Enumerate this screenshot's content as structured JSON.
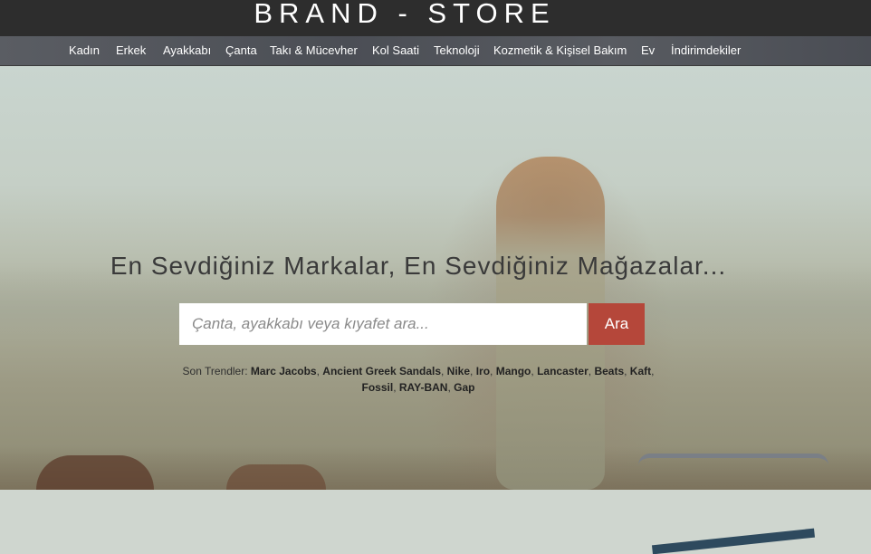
{
  "header": {
    "logo": "BRAND - STORE"
  },
  "nav": {
    "items": [
      {
        "label": "Kadın"
      },
      {
        "label": "Erkek"
      },
      {
        "label": "Ayakkabı"
      },
      {
        "label": "Çanta"
      },
      {
        "label": "Takı & Mücevher"
      },
      {
        "label": "Kol Saati"
      },
      {
        "label": "Teknoloji"
      },
      {
        "label": "Kozmetik & Kişisel Bakım"
      },
      {
        "label": "Ev"
      },
      {
        "label": "İndirimdekiler"
      }
    ]
  },
  "hero": {
    "headline": "En Sevdiğiniz Markalar, En Sevdiğiniz Mağazalar...",
    "search": {
      "placeholder": "Çanta, ayakkabı veya kıyafet ara...",
      "value": "",
      "button_label": "Ara"
    },
    "trends": {
      "label": "Son Trendler:",
      "items": [
        "Marc Jacobs",
        "Ancient Greek Sandals",
        "Nike",
        "Iro",
        "Mango",
        "Lancaster",
        "Beats",
        "Kaft",
        "Fossil",
        "RAY-BAN",
        "Gap"
      ]
    }
  },
  "colors": {
    "topbar": "#2d2d2d",
    "nav": "#54575e",
    "search_button": "#b5473a"
  }
}
